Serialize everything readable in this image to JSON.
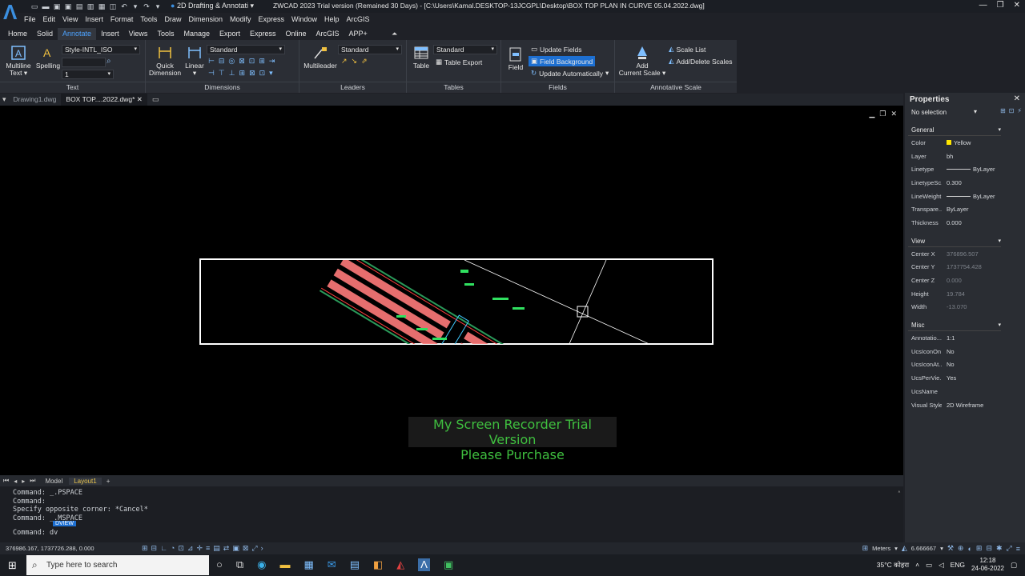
{
  "titlebar": {
    "workspace": "2D Drafting & Annotati",
    "title": "ZWCAD 2023 Trial version (Remained 30 Days) - [C:\\Users\\Kamal.DESKTOP-13JCGPL\\Desktop\\BOX TOP PLAN IN CURVE 05.04.2022.dwg]"
  },
  "menu": [
    "File",
    "Edit",
    "View",
    "Insert",
    "Format",
    "Tools",
    "Draw",
    "Dimension",
    "Modify",
    "Express",
    "Window",
    "Help",
    "ArcGIS"
  ],
  "ribbon_tabs": [
    {
      "label": "Home",
      "active": false
    },
    {
      "label": "Solid",
      "active": false
    },
    {
      "label": "Annotate",
      "active": true
    },
    {
      "label": "Insert",
      "active": false
    },
    {
      "label": "Views",
      "active": false
    },
    {
      "label": "Tools",
      "active": false
    },
    {
      "label": "Manage",
      "active": false
    },
    {
      "label": "Export",
      "active": false
    },
    {
      "label": "Express",
      "active": false
    },
    {
      "label": "Online",
      "active": false
    },
    {
      "label": "ArcGIS",
      "active": false
    },
    {
      "label": "APP+",
      "active": false
    }
  ],
  "ribbon": {
    "text": {
      "title": "Text",
      "multiline": "Multiline",
      "multiline2": "Text",
      "spelling": "Spelling",
      "style": "Style-INTL_ISO",
      "height": "1"
    },
    "dimensions": {
      "title": "Dimensions",
      "quick": "Quick",
      "quick2": "Dimension",
      "linear": "Linear",
      "style": "Standard"
    },
    "leaders": {
      "title": "Leaders",
      "multileader": "Multileader",
      "style": "Standard"
    },
    "tables": {
      "title": "Tables",
      "table": "Table",
      "style": "Standard",
      "export": "Table Export"
    },
    "fields": {
      "title": "Fields",
      "field": "Field",
      "update": "Update Fields",
      "background": "Field Background",
      "auto": "Update Automatically"
    },
    "annoscale": {
      "title": "Annotative Scale",
      "add": "Add",
      "add2": "Current Scale",
      "list": "Scale List",
      "adddel": "Add/Delete Scales"
    }
  },
  "file_tabs": [
    {
      "label": "Drawing1.dwg",
      "active": false
    },
    {
      "label": "BOX TOP....2022.dwg*",
      "active": true
    }
  ],
  "watermark": {
    "line1": "My Screen Recorder Trial Version",
    "line2": "Please Purchase"
  },
  "layout_tabs": [
    {
      "label": "Model",
      "active": false
    },
    {
      "label": "Layout1",
      "active": true
    }
  ],
  "command": {
    "lines": [
      "Command: _.PSPACE",
      "Command:",
      "Specify opposite corner: *Cancel*",
      "Command: _.MSPACE"
    ],
    "autocomplete": "DVIEW",
    "prompt": "Command: dv"
  },
  "status": {
    "coords": "376986.167, 1737726.288, 0.000",
    "units": "Meters",
    "scale": "6.666667"
  },
  "properties": {
    "title": "Properties",
    "selection": "No selection",
    "general": {
      "title": "General",
      "rows": [
        {
          "k": "Color",
          "v": "Yellow"
        },
        {
          "k": "Layer",
          "v": "bh"
        },
        {
          "k": "Linetype",
          "v": "ByLayer"
        },
        {
          "k": "LinetypeSc...",
          "v": "0.300"
        },
        {
          "k": "LineWeight",
          "v": "ByLayer"
        },
        {
          "k": "Transpare...",
          "v": "ByLayer"
        },
        {
          "k": "Thickness",
          "v": "0.000"
        }
      ]
    },
    "view": {
      "title": "View",
      "rows": [
        {
          "k": "Center X",
          "v": "376896.507"
        },
        {
          "k": "Center Y",
          "v": "1737754.428"
        },
        {
          "k": "Center Z",
          "v": "0.000"
        },
        {
          "k": "Height",
          "v": "19.784"
        },
        {
          "k": "Width",
          "v": "-13.070"
        }
      ]
    },
    "misc": {
      "title": "Misc",
      "rows": [
        {
          "k": "Annotatio...",
          "v": "1:1"
        },
        {
          "k": "UcsIconOn",
          "v": "No"
        },
        {
          "k": "UcsIconAt...",
          "v": "No"
        },
        {
          "k": "UcsPerVie...",
          "v": "Yes"
        },
        {
          "k": "UcsName",
          "v": ""
        },
        {
          "k": "Visual Style",
          "v": "2D Wireframe"
        }
      ]
    }
  },
  "taskbar": {
    "search": "Type here to search",
    "weather": "35°C कोहरा",
    "lang": "ENG",
    "time": "12:18",
    "date": "24-06-2022"
  }
}
